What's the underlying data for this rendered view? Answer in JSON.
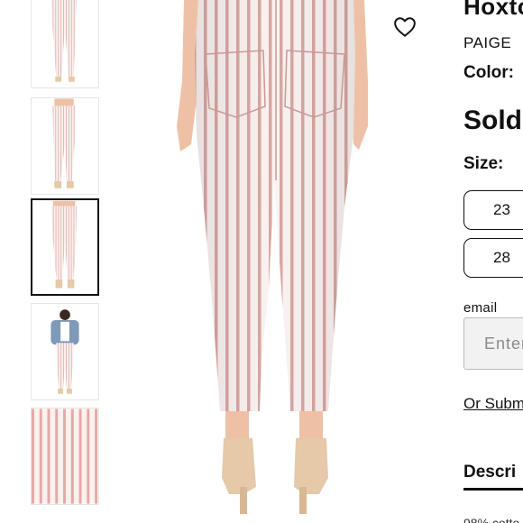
{
  "product": {
    "title": "Hoxton",
    "brand": "PAIGE",
    "color_label": "Color:",
    "status": "Sold",
    "size_label": "Size:",
    "sizes": [
      "23",
      "28"
    ],
    "email_label": "email",
    "email_placeholder": "Enter",
    "submit_link": "Or Subm",
    "description_heading": "Descri",
    "description_text": "98% cotto"
  },
  "thumbnails": [
    {
      "label": "front-full-view",
      "selected": false
    },
    {
      "label": "side-full-view",
      "selected": false
    },
    {
      "label": "back-full-view",
      "selected": true
    },
    {
      "label": "styled-outfit-view",
      "selected": false
    },
    {
      "label": "fabric-detail-view",
      "selected": false
    }
  ],
  "icons": {
    "wishlist": "heart-outline-icon"
  },
  "colors": {
    "stripe": "#d9a7a4",
    "fabric": "#fbf3f1",
    "skin": "#eec1a6",
    "sandal": "#e5c9a8",
    "border_dark": "#111111"
  }
}
